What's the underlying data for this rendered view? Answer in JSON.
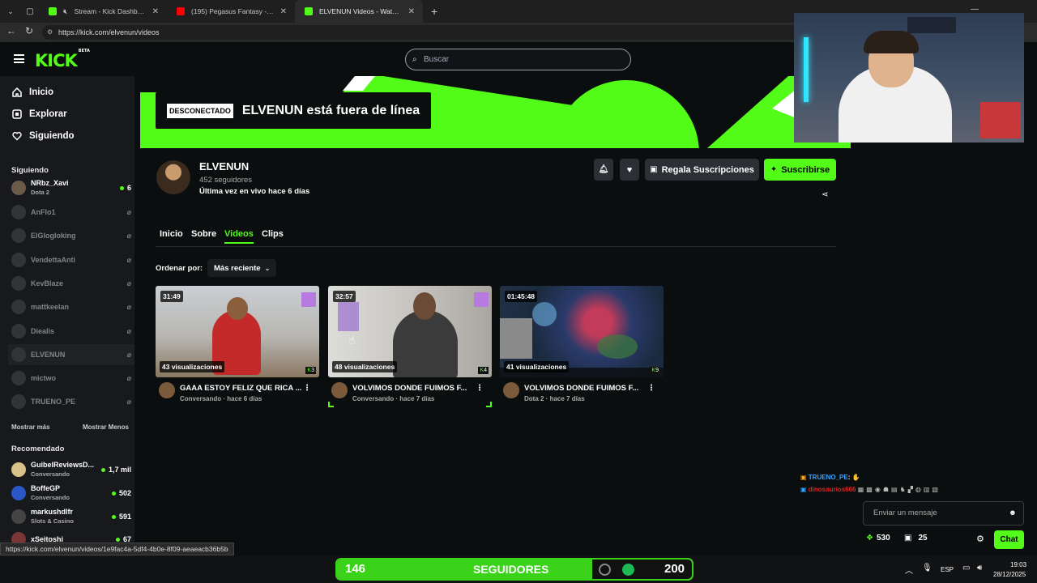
{
  "browser": {
    "tabs": [
      {
        "title": "Stream - Kick Dashboard",
        "fav": "#53fc18"
      },
      {
        "title": "(195) Pegasus Fantasy - Saint Seiya",
        "fav": "#ff0000"
      },
      {
        "title": "ELVENUN Videos - Watch On-Demand",
        "fav": "#53fc18"
      }
    ],
    "url": "https://kick.com/elvenun/videos",
    "status_url": "https://kick.com/elvenun/videos/1e9fac4a-5df4-4b0e-8f09-aeaeacb36b5b"
  },
  "kick": {
    "logo": "KICK",
    "logo_badge": "BETA",
    "search_placeholder": "Buscar",
    "nav": [
      {
        "label": "Inicio",
        "icon": "home-icon"
      },
      {
        "label": "Explorar",
        "icon": "compass-icon"
      },
      {
        "label": "Siguiendo",
        "icon": "heart-icon"
      }
    ],
    "following_title": "Siguiendo",
    "following": [
      {
        "name": "NRbz_Xavi",
        "sub": "Dota 2",
        "count": "6",
        "live": true
      },
      {
        "name": "AnFlo1",
        "live": false
      },
      {
        "name": "ElGlogloking",
        "live": false
      },
      {
        "name": "VendettaAnti",
        "live": false
      },
      {
        "name": "KevBlaze",
        "live": false
      },
      {
        "name": "mattkeelan",
        "live": false
      },
      {
        "name": "Diealis",
        "live": false
      },
      {
        "name": "ELVENUN",
        "live": false
      },
      {
        "name": "mictwo",
        "live": false
      },
      {
        "name": "TRUENO_PE",
        "live": false
      }
    ],
    "show_more": "Mostrar más",
    "show_less": "Mostrar Menos",
    "recommended_title": "Recomendado",
    "recommended": [
      {
        "name": "GuibelReviewsD...",
        "sub": "Conversando",
        "count": "1,7 mil"
      },
      {
        "name": "BoffeGP",
        "sub": "Conversando",
        "count": "502"
      },
      {
        "name": "markushdlfr",
        "sub": "Slots & Casino",
        "count": "591"
      },
      {
        "name": "xSeitoshi",
        "sub": "",
        "count": "67"
      }
    ]
  },
  "banner": {
    "tag": "DESCONECTADO",
    "text": "ELVENUN está fuera de línea"
  },
  "channel": {
    "name": "ELVENUN",
    "followers": "452 seguidores",
    "last_live": "Última vez en vivo hace 6 días",
    "gift_label": "Regala Suscripciones",
    "subscribe_label": "Suscribirse",
    "tabs": [
      "Inicio",
      "Sobre",
      "Videos",
      "Clips"
    ],
    "active_tab": "Videos",
    "sort_label": "Ordenar por:",
    "sort_value": "Más reciente"
  },
  "videos": [
    {
      "duration": "31:49",
      "views": "43 visualizaciones",
      "title": "GAAA ESTOY FELIZ QUE RICA ...",
      "category": "Conversando",
      "age": "hace 6 días",
      "badge": "3"
    },
    {
      "duration": "32:57",
      "views": "48 visualizaciones",
      "title": "VOLVIMOS DONDE FUIMOS F...",
      "category": "Conversando",
      "age": "hace 7 días",
      "badge": "4"
    },
    {
      "duration": "01:45:48",
      "views": "41 visualizaciones",
      "title": "VOLVIMOS DONDE FUIMOS F...",
      "category": "Dota 2",
      "age": "hace 7 días",
      "badge": "9"
    }
  ],
  "chat": {
    "line1_user": "TRUENO_PE",
    "line2_user": "dinosaurios666",
    "input_placeholder": "Enviar un mensaje",
    "points": "530",
    "gifts": "25",
    "chat_button": "Chat"
  },
  "overlay": {
    "left_count": "146",
    "label": "SEGUIDORES",
    "right_count": "200"
  },
  "taskbar": {
    "lang": "ESP",
    "time": "19:03",
    "date": "28/12/2025"
  }
}
